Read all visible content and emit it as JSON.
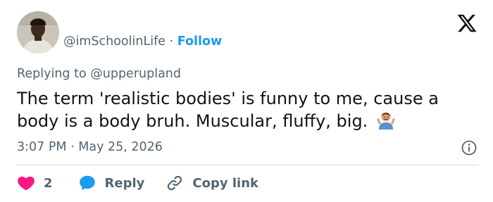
{
  "author": {
    "display_name": "",
    "handle": "@imSchoolinLife",
    "separator": "·",
    "follow_label": "Follow"
  },
  "replying": {
    "prefix": "Replying to",
    "target": "@upperupland"
  },
  "tweet": {
    "text": "The term 'realistic bodies' is funny to me, cause a body is a body bruh. Muscular, fluffy, big."
  },
  "meta": {
    "time": "3:07 PM",
    "separator": "·",
    "date": "May 25, 2026"
  },
  "actions": {
    "like_count": "2",
    "reply_label": "Reply",
    "copy_link_label": "Copy link"
  },
  "colors": {
    "accent": "#1d9bf0",
    "like": "#f91880",
    "secondary_text": "#536471",
    "primary_text": "#0f1419",
    "divider": "#cfd9de"
  },
  "icons": [
    "x-logo-icon",
    "info-icon",
    "heart-icon",
    "reply-bubble-icon",
    "link-icon",
    "shrug-emoji-icon"
  ]
}
